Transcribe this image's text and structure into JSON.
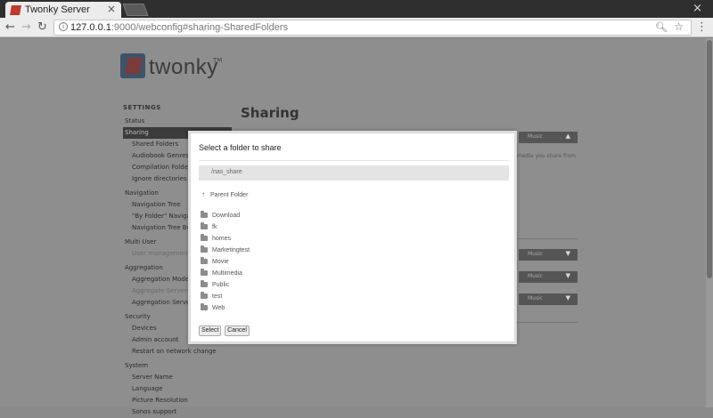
{
  "browser": {
    "tab_title": "Twonky Server",
    "tab_close": "×",
    "window_close": "×",
    "back": "←",
    "forward": "→",
    "reload": "↻",
    "url_host": "127.0.0.1",
    "url_path": ":9000/webconfig#sharing-SharedFolders",
    "menu": "⋮"
  },
  "brand": {
    "logo_text": "twonky",
    "logo_tm": "TM"
  },
  "sidebar": {
    "heading": "SETTINGS",
    "items": [
      {
        "label": "Status"
      },
      {
        "label": "Sharing"
      },
      {
        "label": "Shared Folders"
      },
      {
        "label": "Audiobook Genres"
      },
      {
        "label": "Compilation Folders"
      },
      {
        "label": "Ignore directories"
      },
      {
        "label": "Navigation"
      },
      {
        "label": "Navigation Tree"
      },
      {
        "label": "\"By Folder\" Navigation"
      },
      {
        "label": "Navigation Tree Builder"
      },
      {
        "label": "Multi User"
      },
      {
        "label": "User management"
      },
      {
        "label": "Aggregation"
      },
      {
        "label": "Aggregation Mode"
      },
      {
        "label": "Aggregate Servers"
      },
      {
        "label": "Aggregation Servers"
      },
      {
        "label": "Security"
      },
      {
        "label": "Devices"
      },
      {
        "label": "Admin account"
      },
      {
        "label": "Restart on network change"
      },
      {
        "label": "System"
      },
      {
        "label": "Server Name"
      },
      {
        "label": "Language"
      },
      {
        "label": "Picture Resolution"
      },
      {
        "label": "Sonos support"
      }
    ]
  },
  "main": {
    "title": "Sharing",
    "stub_text": "media you share from",
    "stub_buttons": [
      {
        "label": "Music"
      },
      {
        "label": "Music"
      },
      {
        "label": "Music"
      },
      {
        "label": "Music"
      }
    ]
  },
  "dialog": {
    "title": "Select a folder to share",
    "current_path": "/nas_share",
    "parent_folder": "Parent Folder",
    "folders": [
      {
        "name": "Download"
      },
      {
        "name": "fk"
      },
      {
        "name": "homes"
      },
      {
        "name": "Marketingtest"
      },
      {
        "name": "Movie"
      },
      {
        "name": "Multimedia"
      },
      {
        "name": "Public"
      },
      {
        "name": "test"
      },
      {
        "name": "Web"
      }
    ],
    "select_label": "Select",
    "cancel_label": "Cancel"
  }
}
